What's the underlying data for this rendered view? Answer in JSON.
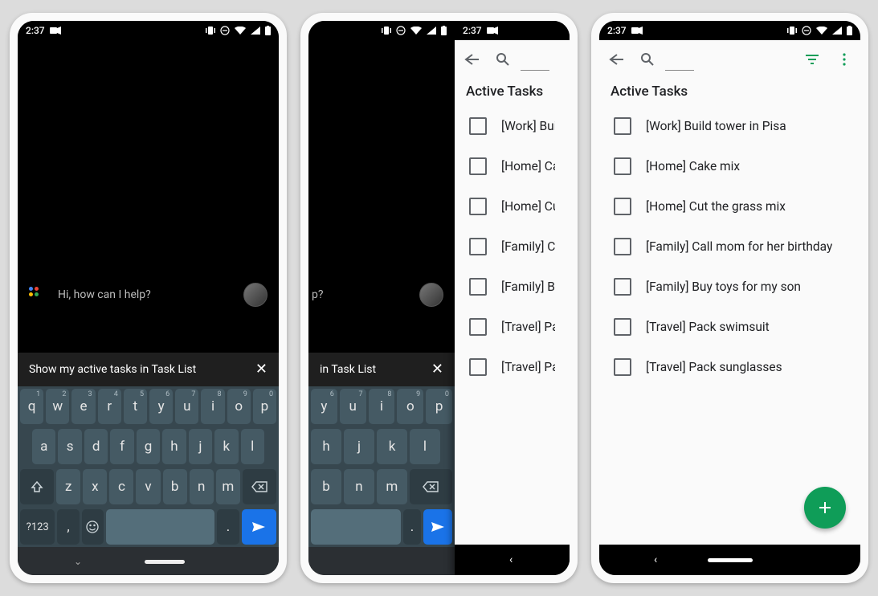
{
  "status": {
    "time": "2:37"
  },
  "assistant": {
    "greeting": "Hi, how can I help?",
    "question_suffix": "p?",
    "suggestion_full": "Show my active tasks in Task List",
    "suggestion_partial": "in Task List"
  },
  "keyboard": {
    "row1": [
      {
        "k": "q",
        "n": "1"
      },
      {
        "k": "w",
        "n": "2"
      },
      {
        "k": "e",
        "n": "3"
      },
      {
        "k": "r",
        "n": "4"
      },
      {
        "k": "t",
        "n": "5"
      },
      {
        "k": "y",
        "n": "6"
      },
      {
        "k": "u",
        "n": "7"
      },
      {
        "k": "i",
        "n": "8"
      },
      {
        "k": "o",
        "n": "9"
      },
      {
        "k": "p",
        "n": "0"
      }
    ],
    "row1_partial": [
      {
        "k": "y",
        "n": "6"
      },
      {
        "k": "u",
        "n": "7"
      },
      {
        "k": "i",
        "n": "8"
      },
      {
        "k": "o",
        "n": "9"
      },
      {
        "k": "p",
        "n": "0"
      }
    ],
    "row2": [
      "a",
      "s",
      "d",
      "f",
      "g",
      "h",
      "j",
      "k",
      "l"
    ],
    "row2_partial": [
      "h",
      "j",
      "k",
      "l"
    ],
    "row3": [
      "z",
      "x",
      "c",
      "v",
      "b",
      "n",
      "m"
    ],
    "row3_partial": [
      "b",
      "n",
      "m"
    ],
    "sym": "?123",
    "comma": ",",
    "period": "."
  },
  "taskApp": {
    "sectionTitle": "Active Tasks",
    "tasks": [
      "[Work] Build tower in Pisa",
      "[Home] Cake mix",
      "[Home] Cut the grass mix",
      "[Family] Call mom for her birthday",
      "[Family] Buy toys for my son",
      "[Travel] Pack swimsuit",
      "[Travel] Pack sunglasses"
    ],
    "tasks_truncated": [
      "[Work] Build t",
      "[Home] Cake",
      "[Home] Cut th",
      "[Family] Call m",
      "[Family] Buy t",
      "[Travel] Pack s",
      "[Travel] Pack s"
    ]
  }
}
